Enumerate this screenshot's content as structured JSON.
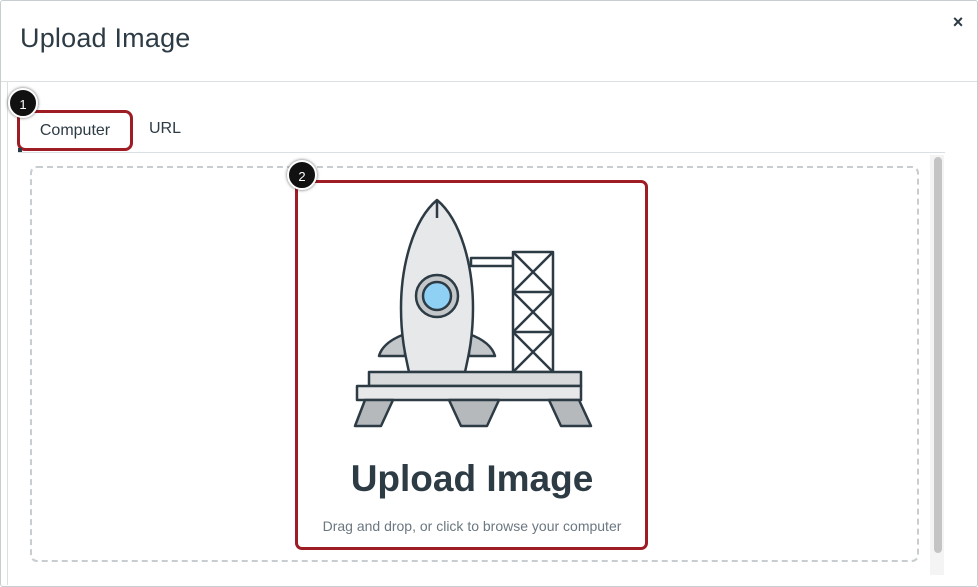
{
  "dialog": {
    "title": "Upload Image",
    "close_label": "×"
  },
  "tabs": [
    {
      "label": "Computer",
      "selected": true
    },
    {
      "label": "URL",
      "selected": false
    }
  ],
  "callouts": [
    "1",
    "2"
  ],
  "dropzone": {
    "heading": "Upload Image",
    "subtext": "Drag and drop, or click to browse your computer",
    "illustration": "rocket-launch-pad-icon"
  },
  "colors": {
    "highlight": "#9e1c24",
    "text": "#2d3b45",
    "muted": "#6b7780",
    "rocket_window": "#8fd1f4"
  }
}
